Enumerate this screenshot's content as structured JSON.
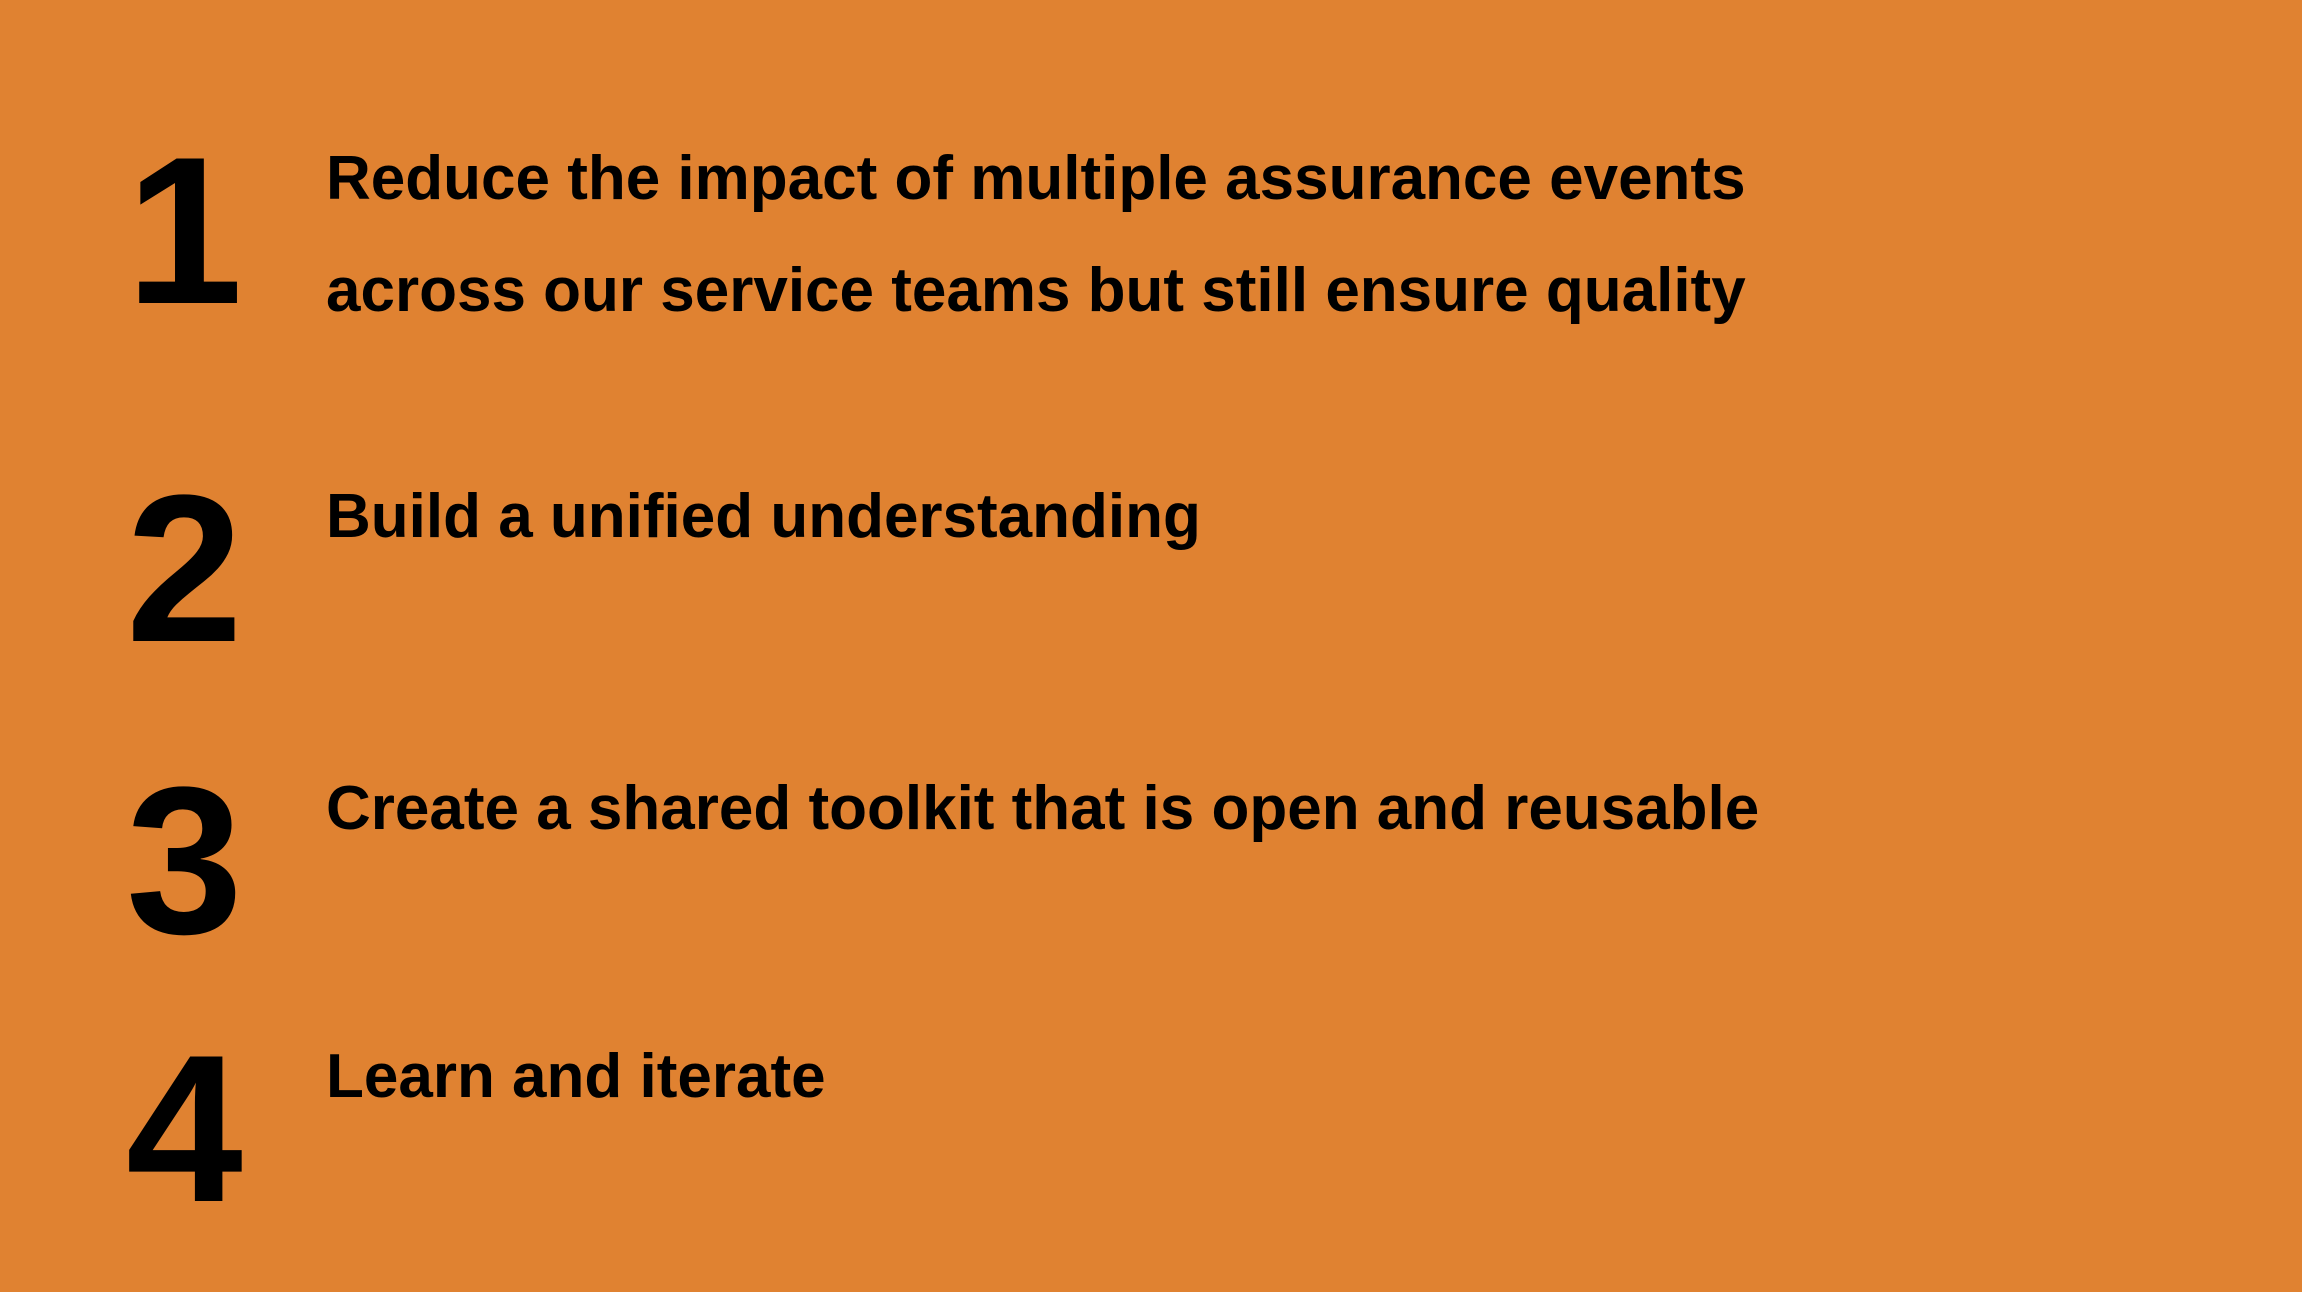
{
  "items": [
    {
      "number": "1",
      "lines": [
        "Reduce the impact of multiple assurance events",
        "across our service teams but still ensure quality"
      ]
    },
    {
      "number": "2",
      "lines": [
        "Build a unified understanding"
      ]
    },
    {
      "number": "3",
      "lines": [
        "Create a shared toolkit that is open and reusable"
      ]
    },
    {
      "number": "4",
      "lines": [
        "Learn and iterate"
      ]
    }
  ],
  "colors": {
    "background": "#e08231",
    "text": "#000000"
  }
}
